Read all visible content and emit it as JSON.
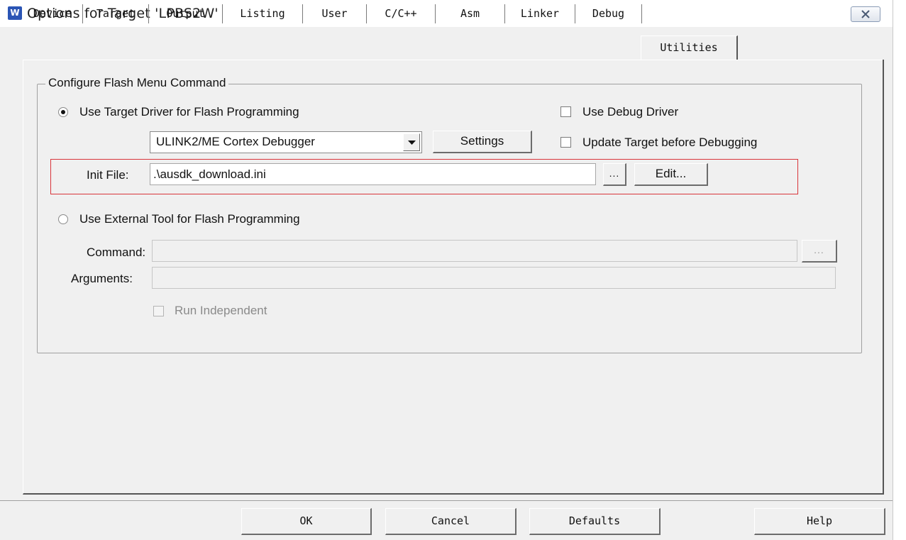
{
  "window": {
    "title": "Options for Target 'LPBS2W'",
    "app_icon_glyph": "W",
    "app_icon_name": "keil-uvision-icon",
    "close_icon": "close-icon"
  },
  "tabs": [
    {
      "label": "Device",
      "active": false
    },
    {
      "label": "Target",
      "active": false
    },
    {
      "label": "Output",
      "active": false
    },
    {
      "label": "Listing",
      "active": false
    },
    {
      "label": "User",
      "active": false
    },
    {
      "label": "C/C++",
      "active": false
    },
    {
      "label": "Asm",
      "active": false
    },
    {
      "label": "Linker",
      "active": false
    },
    {
      "label": "Debug",
      "active": false
    },
    {
      "label": "Utilities",
      "active": true
    }
  ],
  "flash_group": {
    "title": "Configure Flash Menu Command",
    "use_target_driver": {
      "label": "Use Target Driver for Flash Programming",
      "selected": true
    },
    "driver_select": {
      "value": "ULINK2/ME Cortex Debugger"
    },
    "settings_button": "Settings",
    "use_debug_driver": {
      "label": "Use Debug Driver",
      "checked": false
    },
    "update_target": {
      "label": "Update Target before Debugging",
      "checked": false
    },
    "init_file": {
      "label": "Init File:",
      "value": ".\\ausdk_download.ini"
    },
    "browse_button": "...",
    "edit_button": "Edit...",
    "use_external_tool": {
      "label": "Use External Tool for Flash Programming",
      "selected": false
    },
    "command": {
      "label": "Command:",
      "value": ""
    },
    "command_browse_button": "...",
    "arguments": {
      "label": "Arguments:",
      "value": ""
    },
    "run_independent": {
      "label": "Run Independent",
      "checked": false,
      "disabled": true
    }
  },
  "footer": {
    "ok": "OK",
    "cancel": "Cancel",
    "defaults": "Defaults",
    "help": "Help"
  },
  "colors": {
    "dialog_bg": "#f0f0f0",
    "highlight_border": "#d9343a",
    "icon_blue": "#2b55b5"
  }
}
